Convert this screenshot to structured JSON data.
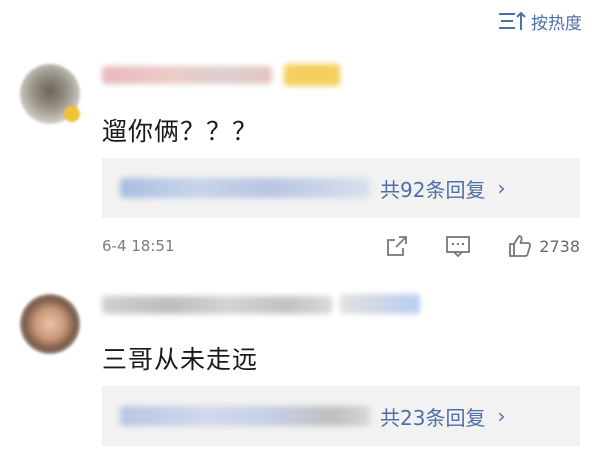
{
  "sort": {
    "label": "按热度",
    "icon": "sort-lines-arrow-icon"
  },
  "comments": [
    {
      "author_name": "",
      "author_blurred": true,
      "text": "遛你俩？？？",
      "reply_preview": "",
      "reply_count_label": "共92条回复",
      "timestamp": "6-4 18:51",
      "like_count": "2738",
      "icons": [
        "share-icon",
        "comment-icon",
        "like-icon",
        "chevron-right-icon"
      ]
    },
    {
      "author_name": "",
      "author_blurred": true,
      "text": "三哥从未走远",
      "reply_preview": "",
      "reply_count_label": "共23条回复",
      "icons": [
        "chevron-right-icon"
      ]
    }
  ],
  "colors": {
    "link_blue": "#4f6fa8",
    "reply_bg": "#f2f2f2",
    "meta_gray": "#7c7c7c",
    "badge_gold": "#f1c233"
  }
}
